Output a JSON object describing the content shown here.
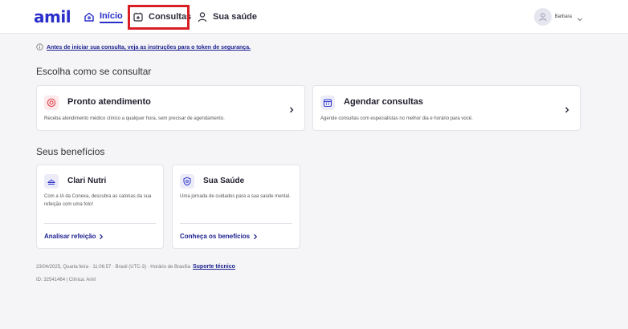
{
  "header": {
    "logo": "amil",
    "nav": {
      "home_label": "Início",
      "consultas_label": "Consultas",
      "saude_label": "Sua saúde"
    },
    "user_name": "Barbara"
  },
  "info": {
    "link_text": "Antes de iniciar sua consulta, veja as instruções para o token de segurança."
  },
  "sections": {
    "consult_title": "Escolha como se consultar",
    "benefits_title": "Seus benefícios"
  },
  "cards": {
    "pronto": {
      "title": "Pronto atendimento",
      "desc": "Receba atendimento médico clínico a qualquer hora, sem precisar de agendamento."
    },
    "agendar": {
      "title": "Agendar consultas",
      "desc": "Agende consultas com especialistas no melhor dia e horário para você."
    },
    "nutri": {
      "title": "Clari Nutri",
      "desc": "Com a IA da Conexa, descubra as calorias da sua refeição com uma foto!",
      "link": "Analisar refeição"
    },
    "saude": {
      "title": "Sua Saúde",
      "desc": "Uma jornada de cuidados para a sua saúde mental.",
      "link": "Conheça os benefícios"
    }
  },
  "footer": {
    "datetime": "23/04/2025, Quarta feira · 11:06:57 · Brasil (UTC-3) · Horário de Brasília",
    "support": "Suporte técnico",
    "ids": "ID: 32541464 | Clínica: Amil"
  },
  "colors": {
    "brand": "#2a2fc9",
    "highlight": "#d81f26",
    "pronto_icon_bg": "#fde8ea",
    "agendar_icon_bg": "#ececf9"
  }
}
